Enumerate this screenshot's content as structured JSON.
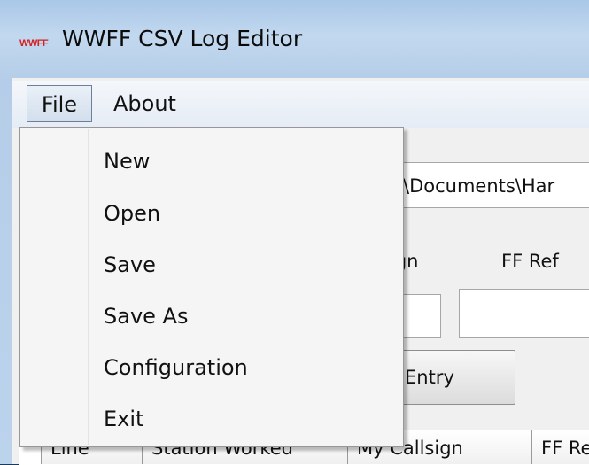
{
  "window": {
    "logo_text": "WWFF",
    "title": "WWFF CSV Log Editor"
  },
  "menubar": {
    "items": [
      {
        "label": "File"
      },
      {
        "label": "About"
      }
    ]
  },
  "file_menu": {
    "items": [
      {
        "label": "New"
      },
      {
        "label": "Open"
      },
      {
        "label": "Save"
      },
      {
        "label": "Save As"
      },
      {
        "label": "Configuration"
      },
      {
        "label": "Exit"
      }
    ]
  },
  "form": {
    "path_value": "\\Documents\\Har",
    "label_callsign_partial": "ign",
    "label_ffref": "FF Ref",
    "entry_button_label": "Entry"
  },
  "grid": {
    "columns": [
      {
        "label": "Line"
      },
      {
        "label": "Station Worked"
      },
      {
        "label": "My Callsign"
      },
      {
        "label": "FF Re"
      }
    ]
  },
  "colors": {
    "title_gradient_top": "#a9c7e8",
    "logo_red": "#d42020",
    "menu_bg": "#f5f5f5"
  }
}
